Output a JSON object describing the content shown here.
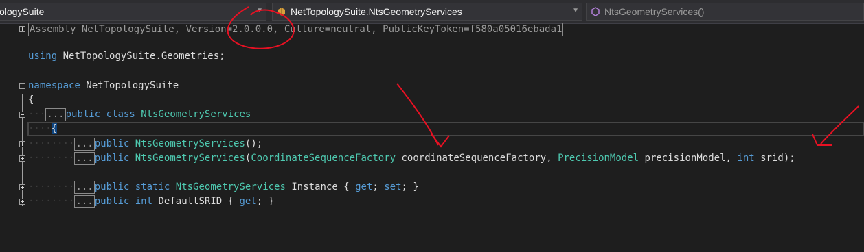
{
  "nav_bar": {
    "project_combo": {
      "value": "ologySuite"
    },
    "type_combo": {
      "value": "NetTopologySuite.NtsGeometryServices",
      "icon": "class-icon"
    },
    "member_combo": {
      "value": "NtsGeometryServices()",
      "icon": "method-icon"
    }
  },
  "code": {
    "assembly_line": "Assembly NetTopologySuite, Version=2.0.0.0, Culture=neutral, PublicKeyToken=f580a05016ebada1",
    "using_kw": "using",
    "using_ns": "NetTopologySuite.Geometries;",
    "namespace_kw": "namespace",
    "namespace_name": "NetTopologySuite",
    "open_brace": "{",
    "collapsed": "...",
    "public_kw": "public",
    "class_kw": "class",
    "class_name": "NtsGeometryServices",
    "class_brace": "{",
    "ctor1_name": "NtsGeometryServices",
    "ctor1_rest": "();",
    "ctor2_name": "NtsGeometryServices",
    "ctor2_paren": "(",
    "ctor2_t1": "CoordinateSequenceFactory",
    "ctor2_p1": " coordinateSequenceFactory, ",
    "ctor2_t2": "PrecisionModel",
    "ctor2_p2": " precisionModel, ",
    "ctor2_t3": "int",
    "ctor2_p3": " srid);",
    "static_kw": "static",
    "instance_type": "NtsGeometryServices",
    "instance_rest": " Instance { ",
    "get_kw": "get",
    "set_kw": "set",
    "semi_get": "; ",
    "semi_set": "; }",
    "int_kw": "int",
    "srid_prop": " DefaultSRID { ",
    "srid_end": "; }"
  },
  "colors": {
    "keyword": "#569cd6",
    "type": "#4ec9b0",
    "annotation": "#e81123"
  }
}
